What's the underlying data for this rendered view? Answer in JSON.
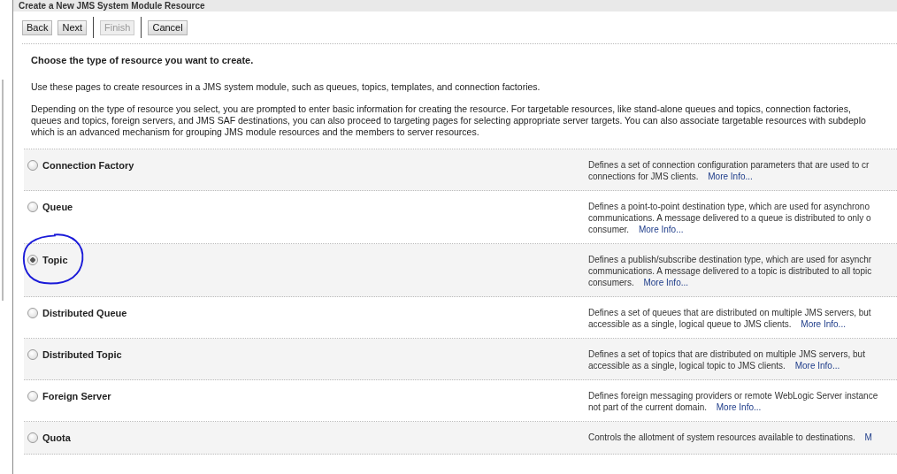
{
  "title": "Create a New JMS System Module Resource",
  "buttons": [
    {
      "label": "Back",
      "disabled": false,
      "divider_before": false
    },
    {
      "label": "Next",
      "disabled": false,
      "divider_before": false
    },
    {
      "label": "Finish",
      "disabled": true,
      "divider_before": true
    },
    {
      "label": "Cancel",
      "disabled": false,
      "divider_before": true
    }
  ],
  "heading": "Choose the type of resource you want to create.",
  "intro": [
    "Use these pages to create resources in a JMS system module, such as queues, topics, templates, and connection factories."
  ],
  "details": [
    "Depending on the type of resource you select, you are prompted to enter basic information for creating the resource. For targetable resources, like stand-alone queues and topics, connection factories,",
    "queues and topics, foreign servers, and JMS SAF destinations, you can also proceed to targeting pages for selecting appropriate server targets. You can also associate targetable resources with subdeplo",
    "which is an advanced mechanism for grouping JMS module resources and the members to server resources."
  ],
  "resource_types": [
    {
      "label": "Connection Factory",
      "selected": false,
      "circled": false,
      "description": [
        "Defines a set of connection configuration parameters that are used to cr",
        "connections for JMS clients."
      ],
      "link": "More Info..."
    },
    {
      "label": "Queue",
      "selected": false,
      "circled": false,
      "description": [
        "Defines a point-to-point destination type, which are used for asynchrono",
        "communications. A message delivered to a queue is distributed to only o",
        "consumer."
      ],
      "link": "More Info..."
    },
    {
      "label": "Topic",
      "selected": true,
      "circled": true,
      "description": [
        "Defines a publish/subscribe destination type, which are used for asynchr",
        "communications. A message delivered to a topic is distributed to all topic",
        "consumers."
      ],
      "link": "More Info..."
    },
    {
      "label": "Distributed Queue",
      "selected": false,
      "circled": false,
      "description": [
        "Defines a set of queues that are distributed on multiple JMS servers, but",
        "accessible as a single, logical queue to JMS clients."
      ],
      "link": "More Info..."
    },
    {
      "label": "Distributed Topic",
      "selected": false,
      "circled": false,
      "description": [
        "Defines a set of topics that are distributed on multiple JMS servers, but",
        "accessible as a single, logical topic to JMS clients."
      ],
      "link": "More Info..."
    },
    {
      "label": "Foreign Server",
      "selected": false,
      "circled": false,
      "description": [
        "Defines foreign messaging providers or remote WebLogic Server instance",
        "not part of the current domain."
      ],
      "link": "More Info..."
    },
    {
      "label": "Quota",
      "selected": false,
      "circled": false,
      "description": [
        "Controls the allotment of system resources available to destinations."
      ],
      "link": "M"
    }
  ]
}
